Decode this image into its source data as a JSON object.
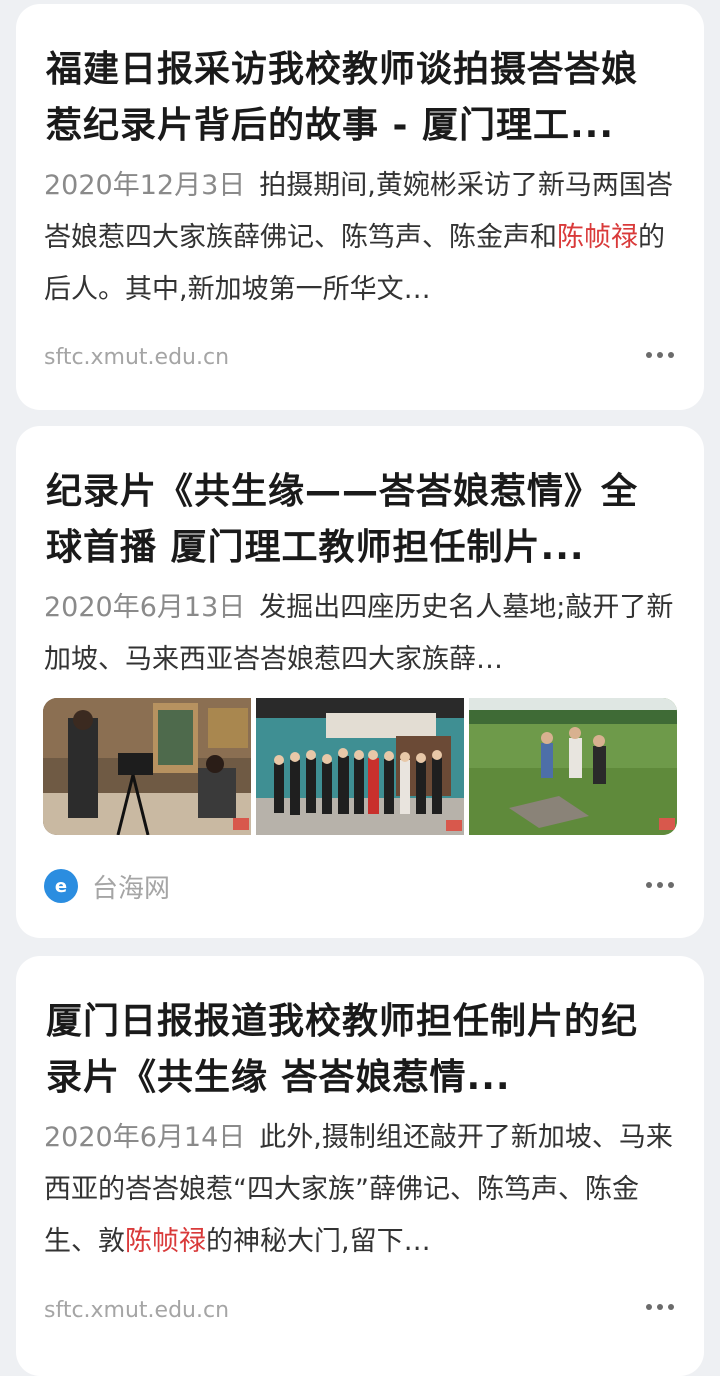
{
  "results": [
    {
      "title": "福建日报采访我校教师谈拍摄峇峇娘惹纪录片背后的故事 - 厦门理工...",
      "date": "2020年12月3日",
      "snippet_parts": [
        {
          "text": "拍摄期间,黄婉彬采访了新马两国峇峇娘惹四大家族薛佛记、陈笃声、陈金声和"
        },
        {
          "text": "陈帧禄",
          "hl": true
        },
        {
          "text": "的后人。其中,新加坡第一所华文…"
        }
      ],
      "source": "sftc.xmut.edu.cn",
      "more_icon": "more-dots-icon"
    },
    {
      "title": "纪录片《共生缘——峇峇娘惹情》全球首播 厦门理工教师担任制片...",
      "date": "2020年6月13日",
      "snippet_parts": [
        {
          "text": "发掘出四座历史名人墓地;敲开了新加坡、马来西亚峇峇娘惹四大家族薛…"
        }
      ],
      "source_name": "台海网",
      "source_logo_icon": "taihai-logo-icon",
      "more_icon": "more-dots-icon"
    },
    {
      "title": "厦门日报报道我校教师担任制片的纪录片《共生缘 峇峇娘惹情...",
      "date": "2020年6月14日",
      "snippet_parts": [
        {
          "text": "此外,摄制组还敲开了新加坡、马来西亚的峇峇娘惹“四大家族”薛佛记、陈笃声、陈金生、敦"
        },
        {
          "text": "陈帧禄",
          "hl": true
        },
        {
          "text": "的神秘大门,留下…"
        }
      ],
      "source": "sftc.xmut.edu.cn",
      "more_icon": "more-dots-icon"
    }
  ],
  "colors": {
    "highlight": "#d93a3a",
    "date": "#8a8a8a",
    "source": "#a5a5a5",
    "background": "#eef0f3"
  }
}
